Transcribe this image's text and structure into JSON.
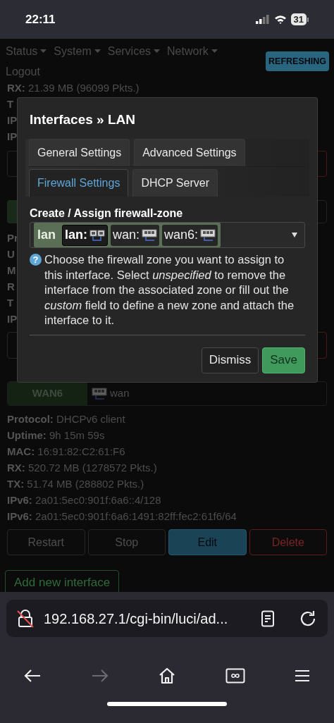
{
  "status_bar": {
    "time": "22:11",
    "battery": "31"
  },
  "nav": {
    "items": [
      {
        "label": "Status",
        "kind": "menu"
      },
      {
        "label": "System",
        "kind": "menu"
      },
      {
        "label": "Services",
        "kind": "menu"
      },
      {
        "label": "Network",
        "kind": "menu"
      },
      {
        "label": "Logout",
        "kind": "link"
      }
    ],
    "badge": "REFRESHING"
  },
  "lan_section": {
    "rx": {
      "label": "RX:",
      "value": "21.39 MB (96099 Pkts.)"
    },
    "cut_labels_a": [
      "T",
      "IP",
      "IP"
    ],
    "cut_labels_b": [
      "Pr",
      "U",
      "M",
      "R",
      "T",
      "IP"
    ]
  },
  "wan6_section": {
    "name": "WAN6",
    "device": "wan",
    "details": [
      {
        "label": "Protocol:",
        "value": "DHCPv6 client"
      },
      {
        "label": "Uptime:",
        "value": "9h 15m 59s"
      },
      {
        "label": "MAC:",
        "value": "16:91:82:C2:61:F6"
      },
      {
        "label": "RX:",
        "value": "520.72 MB (1278572 Pkts.)"
      },
      {
        "label": "TX:",
        "value": "51.74 MB (288802 Pkts.)"
      },
      {
        "label": "IPv6:",
        "value": "2a01:5ec0:901f:6a6::4/128"
      },
      {
        "label": "IPv6:",
        "value": "2a01:5ec0:901f:6a6:1491:82ff:fec2:61f6/64"
      }
    ],
    "buttons": [
      {
        "label": "Restart",
        "kind": "default"
      },
      {
        "label": "Stop",
        "kind": "default"
      },
      {
        "label": "Edit",
        "kind": "edit"
      },
      {
        "label": "Delete",
        "kind": "delete"
      }
    ],
    "add_button": "Add new interface"
  },
  "modal": {
    "title": "Interfaces » LAN",
    "tab_rows": [
      [
        {
          "label": "General Settings",
          "selected": false
        },
        {
          "label": "Advanced Settings",
          "selected": false
        }
      ],
      [
        {
          "label": "Firewall Settings",
          "selected": true
        },
        {
          "label": "DHCP Server",
          "selected": false
        }
      ]
    ],
    "field_label": "Create / Assign firewall-zone",
    "chips": [
      {
        "text": "lan",
        "kind": "zone"
      },
      {
        "text": "lan:",
        "kind": "network",
        "current": true
      },
      {
        "text": "wan:",
        "kind": "network",
        "current": false
      },
      {
        "text": "wan6:",
        "kind": "network",
        "current": false
      }
    ],
    "help_icon": "?",
    "help": "Choose the firewall zone you want to assign to this interface. Select *unspecified* to remove the interface from the associated zone or fill out the *custom* field to define a new zone and attach the interface to it.",
    "buttons": [
      {
        "label": "Dismiss",
        "kind": "default"
      },
      {
        "label": "Save",
        "kind": "primary"
      }
    ]
  },
  "browser": {
    "url": "192.168.27.1/cgi-bin/luci/ad...",
    "toolbar": [
      {
        "kind": "back",
        "disabled": false
      },
      {
        "kind": "forward",
        "disabled": true
      },
      {
        "kind": "home",
        "disabled": false
      },
      {
        "kind": "tabs",
        "disabled": false
      },
      {
        "kind": "menu",
        "disabled": false
      }
    ]
  }
}
